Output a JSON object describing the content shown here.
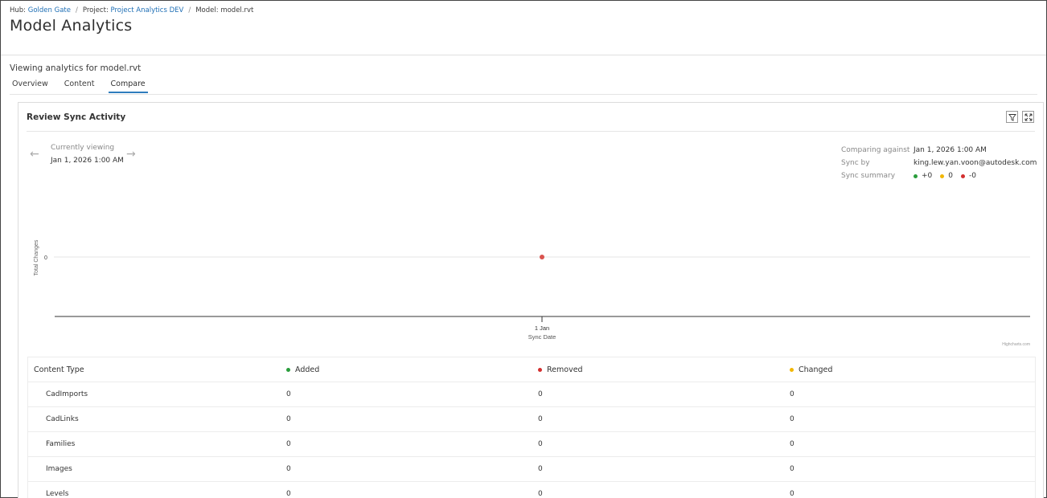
{
  "breadcrumb": {
    "hub_label": "Hub:",
    "hub_value": "Golden Gate",
    "project_label": "Project:",
    "project_value": "Project Analytics DEV",
    "model_label": "Model:",
    "model_value": "model.rvt",
    "separator": "/"
  },
  "page": {
    "title": "Model Analytics",
    "subtitle": "Viewing analytics for model.rvt"
  },
  "tabs": [
    {
      "label": "Overview",
      "active": false
    },
    {
      "label": "Content",
      "active": false
    },
    {
      "label": "Compare",
      "active": true
    }
  ],
  "card": {
    "title": "Review Sync Activity",
    "icons": [
      "filter-icon",
      "expand-icon"
    ],
    "currently_viewing_label": "Currently viewing",
    "currently_viewing_value": "Jan 1, 2026 1:00 AM",
    "comparing_against_label": "Comparing against",
    "comparing_against_value": "Jan 1, 2026 1:00 AM",
    "sync_by_label": "Sync by",
    "sync_by_value": "king.lew.yan.voon@autodesk.com",
    "sync_summary_label": "Sync summary",
    "sync_summary": [
      {
        "value": "+0",
        "color": "#2a9d3c"
      },
      {
        "value": "0",
        "color": "#f2b705"
      },
      {
        "value": "-0",
        "color": "#d32f2f"
      }
    ]
  },
  "chart_data": {
    "type": "scatter",
    "title": "",
    "xlabel": "Sync Date",
    "ylabel": "Total Changes",
    "x_ticks": [
      "1 Jan"
    ],
    "y_ticks": [
      "0"
    ],
    "points": [
      {
        "x": "1 Jan",
        "y": 0,
        "color": "#d9534f"
      }
    ],
    "credit": "Highcharts.com",
    "grid": true,
    "legend": "none"
  },
  "table": {
    "headers": [
      {
        "label": "Content Type",
        "dot": null
      },
      {
        "label": "Added",
        "dot": "#2a9d3c"
      },
      {
        "label": "Removed",
        "dot": "#d32f2f"
      },
      {
        "label": "Changed",
        "dot": "#f2b705"
      }
    ],
    "rows": [
      {
        "type": "CadImports",
        "added": "0",
        "removed": "0",
        "changed": "0"
      },
      {
        "type": "CadLinks",
        "added": "0",
        "removed": "0",
        "changed": "0"
      },
      {
        "type": "Families",
        "added": "0",
        "removed": "0",
        "changed": "0"
      },
      {
        "type": "Images",
        "added": "0",
        "removed": "0",
        "changed": "0"
      },
      {
        "type": "Levels",
        "added": "0",
        "removed": "0",
        "changed": "0"
      }
    ]
  }
}
